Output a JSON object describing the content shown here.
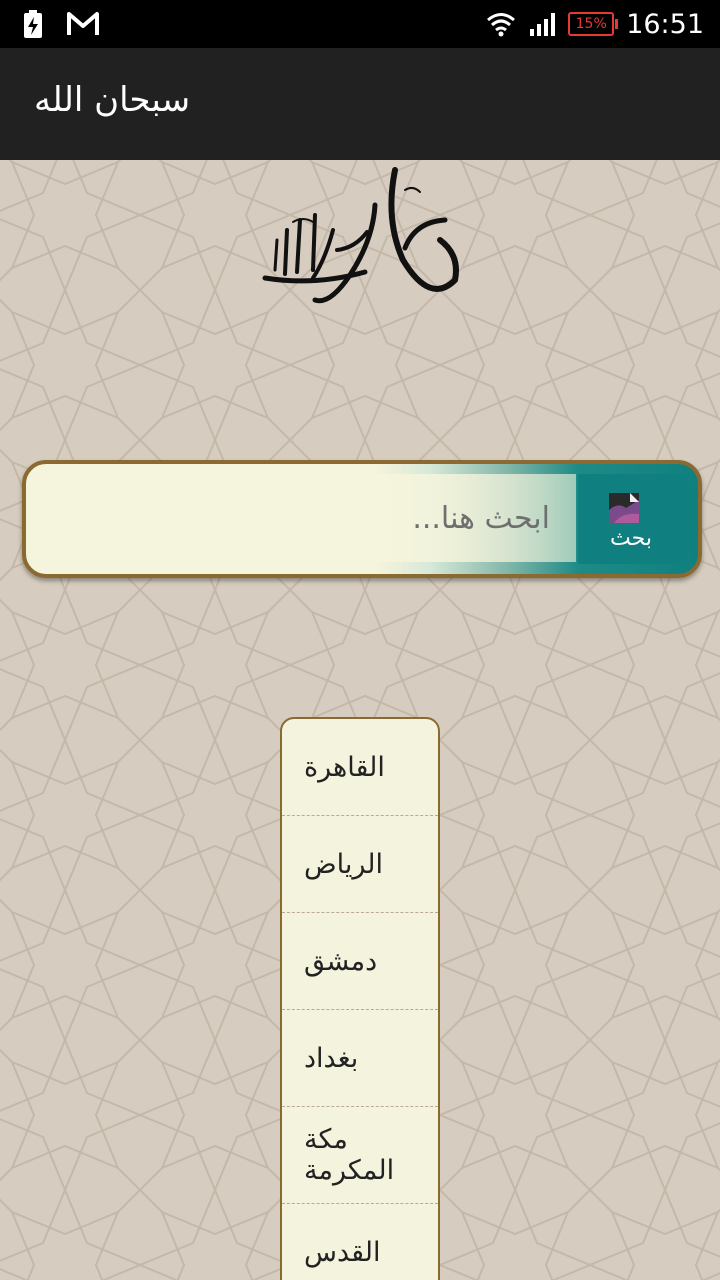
{
  "status_bar": {
    "time": "16:51",
    "battery": "15%",
    "icons": [
      "battery-charging-icon",
      "gmail-icon",
      "wifi-icon",
      "signal-icon"
    ]
  },
  "app_bar": {
    "title": "سبحان الله"
  },
  "header_image": {
    "icon": "calligraphy-logo"
  },
  "search": {
    "placeholder": "ابحث هنا...",
    "value": "",
    "button_label": "بحث",
    "button_icon": "search-image-icon"
  },
  "cities": {
    "items": [
      {
        "label": "القاهرة"
      },
      {
        "label": "الرياض"
      },
      {
        "label": "دمشق"
      },
      {
        "label": "بغداد"
      },
      {
        "label": "مكة المكرمة"
      },
      {
        "label": "القدس"
      }
    ]
  },
  "colors": {
    "app_bar": "#212121",
    "background": "#d6ccbf",
    "accent": "#0f807f",
    "border": "#8b6a32",
    "panel": "#f5f4dc"
  }
}
